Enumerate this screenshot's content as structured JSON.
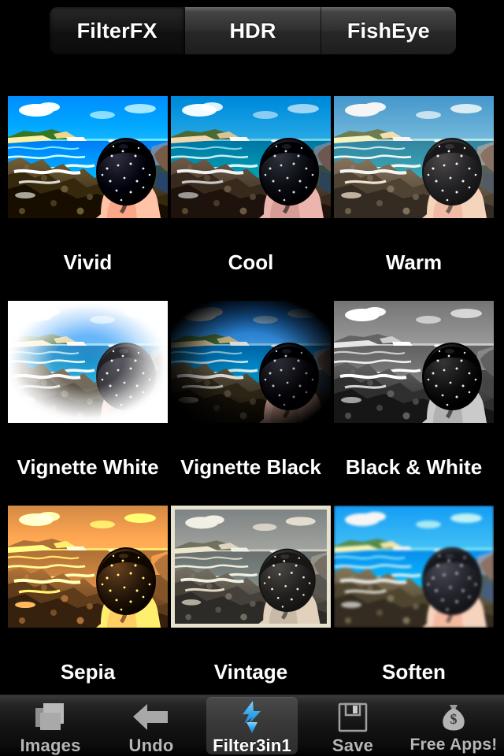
{
  "app": {
    "title": "Filter3in1",
    "background": "#000000"
  },
  "segmented_control": {
    "name": "mode-selector",
    "selected_index": 0,
    "segments": [
      {
        "label": "FilterFX",
        "selected": true
      },
      {
        "label": "HDR",
        "selected": false
      },
      {
        "label": "FishEye",
        "selected": false
      }
    ]
  },
  "filter_grid": {
    "columns": 3,
    "rows": 3,
    "items": [
      {
        "label": "Vivid",
        "style": "f-vivid",
        "vignette": "none",
        "framed": false
      },
      {
        "label": "Cool",
        "style": "f-cool",
        "vignette": "none",
        "framed": false
      },
      {
        "label": "Warm",
        "style": "f-warm",
        "vignette": "none",
        "framed": false
      },
      {
        "label": "Vignette White",
        "style": "f-vwhite",
        "vignette": "white",
        "framed": false
      },
      {
        "label": "Vignette Black",
        "style": "f-vblack",
        "vignette": "black",
        "framed": false
      },
      {
        "label": "Black & White",
        "style": "f-bw",
        "vignette": "none",
        "framed": false
      },
      {
        "label": "Sepia",
        "style": "f-sepia",
        "vignette": "none",
        "framed": false
      },
      {
        "label": "Vintage",
        "style": "f-vintage",
        "vignette": "none",
        "framed": true
      },
      {
        "label": "Soften",
        "style": "f-soften",
        "vignette": "none",
        "framed": false
      }
    ]
  },
  "tab_bar": {
    "selected_index": 2,
    "tabs": [
      {
        "label": "Images",
        "icon": "photo-stack-icon",
        "selected": false
      },
      {
        "label": "Undo",
        "icon": "arrow-left-icon",
        "selected": false
      },
      {
        "label": "Filter3in1",
        "icon": "lightning-bolt-icon",
        "selected": true
      },
      {
        "label": "Save",
        "icon": "floppy-disk-icon",
        "selected": false
      },
      {
        "label": "Free Apps!",
        "icon": "money-bag-icon",
        "selected": false
      }
    ]
  },
  "colors": {
    "accent": "#3aaaf0",
    "tab_label": "#b6b6b6",
    "tab_label_selected": "#ffffff",
    "caption": "#ffffff"
  }
}
